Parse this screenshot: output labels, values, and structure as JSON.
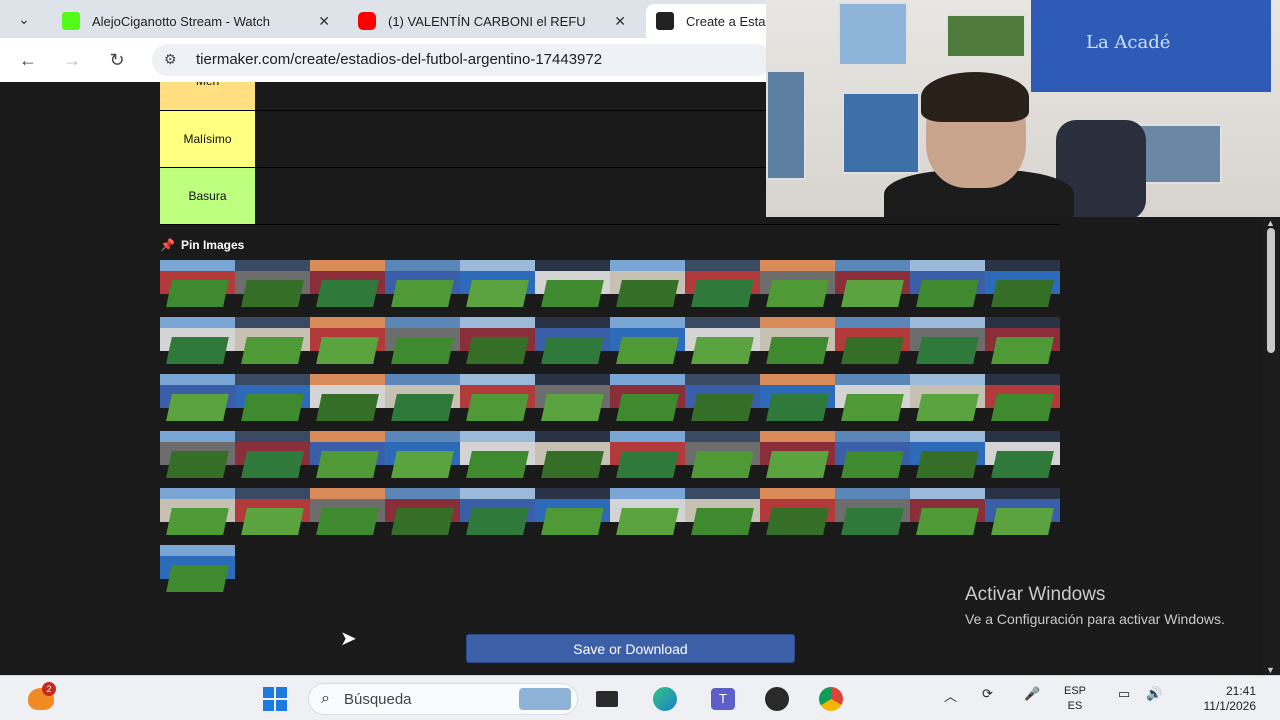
{
  "tabs": [
    {
      "title": "AlejoCiganotto Stream - Watch",
      "favicon_color": "#53fc18"
    },
    {
      "title": "(1) VALENTÍN CARBONI el REFU",
      "favicon_color": "#ff0000"
    },
    {
      "title": "Create a Esta",
      "favicon_color": "#222222"
    }
  ],
  "address": {
    "url": "tiermaker.com/create/estadios-del-futbol-argentino-17443972"
  },
  "tiers": [
    {
      "label": "Meh",
      "color": "#ffdf7f"
    },
    {
      "label": "Malísimo",
      "color": "#ffff7f"
    },
    {
      "label": "Basura",
      "color": "#bfff7f"
    }
  ],
  "pin_images": {
    "title": "Pin Images",
    "count": 61
  },
  "save_button": {
    "label": "Save or Download"
  },
  "watermark": {
    "title": "Activar Windows",
    "subtitle": "Ve a Configuración para activar Windows."
  },
  "webcam": {
    "flag_text": "La Acadé"
  },
  "taskbar": {
    "search_placeholder": "Búsqueda",
    "notification_count": "2",
    "lang_line1": "ESP",
    "lang_line2": "ES",
    "time": "21:41",
    "date": "11/1/2026"
  }
}
